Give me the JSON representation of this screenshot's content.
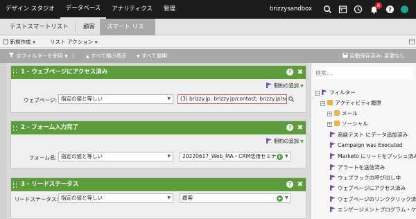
{
  "topnav": {
    "items": [
      "デザイン スタジオ",
      "データベース",
      "アナリティクス",
      "管理"
    ],
    "user": "brizzysandbox",
    "notifications": "8",
    "icons": [
      "search-icon",
      "calendar-icon",
      "clock-icon",
      "bell-icon",
      "help-icon",
      "status-icon"
    ]
  },
  "tabs": [
    "テストスマートリスト",
    "顧客",
    "スマート リスト"
  ],
  "toolbar": {
    "new_label": "新規作成",
    "list_action_label": "リスト アクション"
  },
  "filterbar": {
    "use_all_label": "全フィルターを使用",
    "collapse_label": "すべて縮小表示",
    "expand_label": "すべて展開",
    "autosave_label": "自動保存済み: 変更なし"
  },
  "filters": [
    {
      "title": "1 - ウェブページにアクセス済み",
      "constraint_label": "制約の追加",
      "field_label": "ウェブページ:",
      "operator": "指定の値と等しい",
      "value": "(3) brizzy.jp; brizzy.jp/contact; brizzy.jp/servic"
    },
    {
      "title": "2 - フォーム入力完了",
      "constraint_label": "制約の追加",
      "field_label": "フォーム名:",
      "operator": "指定の値と等しい",
      "value": "20220617_Web_MA・CRM活用セミナー"
    },
    {
      "title": "3 - リードステータス",
      "field_label": "リードステータス:",
      "operator": "指定の値と等しい",
      "value": "顧客"
    }
  ],
  "sidebar": {
    "search_placeholder": "検索...",
    "tree": [
      "フィルター",
      "アクティビティ履歴",
      "メール",
      "ソーシャル",
      "商談テスト にデータ追加済み",
      "Campaign was Executed",
      "Marketo にリードをプッシュ済み",
      "アラートを送信済み",
      "ウェブフックの呼び出し中",
      "ウェブページにアクセス済み",
      "ウェブページのリンククリック済み",
      "エンゲージメントプログラム・ケイ"
    ]
  },
  "colors": {
    "accent_green": "#5c9c3a",
    "nav_bg": "#1c1c1c",
    "badge_red": "#d9222a"
  }
}
